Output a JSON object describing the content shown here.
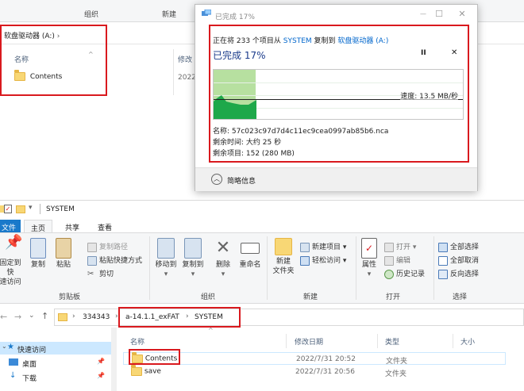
{
  "top_explorer": {
    "ribbon_groups": [
      "组织",
      "新建"
    ],
    "address": "软盘驱动器 (A:)",
    "col_name": "名称",
    "col_modified": "修改",
    "item_name": "Contents",
    "item_date": "2022"
  },
  "dialog": {
    "title": "已完成 17%",
    "copy_prefix": "正在将 233 个项目从",
    "copy_source": "SYSTEM",
    "copy_mid": "复制到",
    "copy_dest": "软盘驱动器 (A:)",
    "progress_heading": "已完成 17%",
    "progress_fraction": 0.17,
    "speed": "速度: 13.5 MB/秒",
    "filename": "名称: 57c023c97d7d4c11ec9cea0997ab85b6.nca",
    "time_left": "剩余时间: 大约 25 秒",
    "items_left": "剩余项目: 152 (280 MB)",
    "less_details": "简略信息",
    "pause_symbol": "II",
    "cancel_symbol": "✕"
  },
  "bottom_explorer": {
    "title": "SYSTEM",
    "tabs": [
      "文件",
      "主页",
      "共享",
      "查看"
    ],
    "ribbon": {
      "pin_label_1": "固定到快",
      "pin_label_2": "速访问",
      "copy": "复制",
      "paste": "粘贴",
      "copy_path": "复制路径",
      "paste_shortcut": "粘贴快捷方式",
      "cut": "剪切",
      "group_clipboard": "剪贴板",
      "move_to": "移动到",
      "copy_to": "复制到",
      "delete": "删除",
      "rename": "重命名",
      "group_organize": "组织",
      "new_folder_1": "新建",
      "new_folder_2": "文件夹",
      "new_item": "新建项目 ▾",
      "easy_access": "轻松访问 ▾",
      "group_new": "新建",
      "properties": "属性",
      "open": "打开 ▾",
      "edit": "编辑",
      "history": "历史记录",
      "group_open": "打开",
      "select_all": "全部选择",
      "select_none": "全部取消",
      "invert": "反向选择",
      "group_select": "选择"
    },
    "breadcrumb": [
      "334343",
      "a-14.1.1_exFAT",
      "SYSTEM"
    ],
    "columns": [
      "名称",
      "修改日期",
      "类型",
      "大小"
    ],
    "sidebar": [
      "快速访问",
      "桌面",
      "下载"
    ],
    "files": [
      {
        "name": "Contents",
        "date": "2022/7/31 20:52",
        "type": "文件夹"
      },
      {
        "name": "save",
        "date": "2022/7/31 20:56",
        "type": "文件夹"
      }
    ]
  }
}
